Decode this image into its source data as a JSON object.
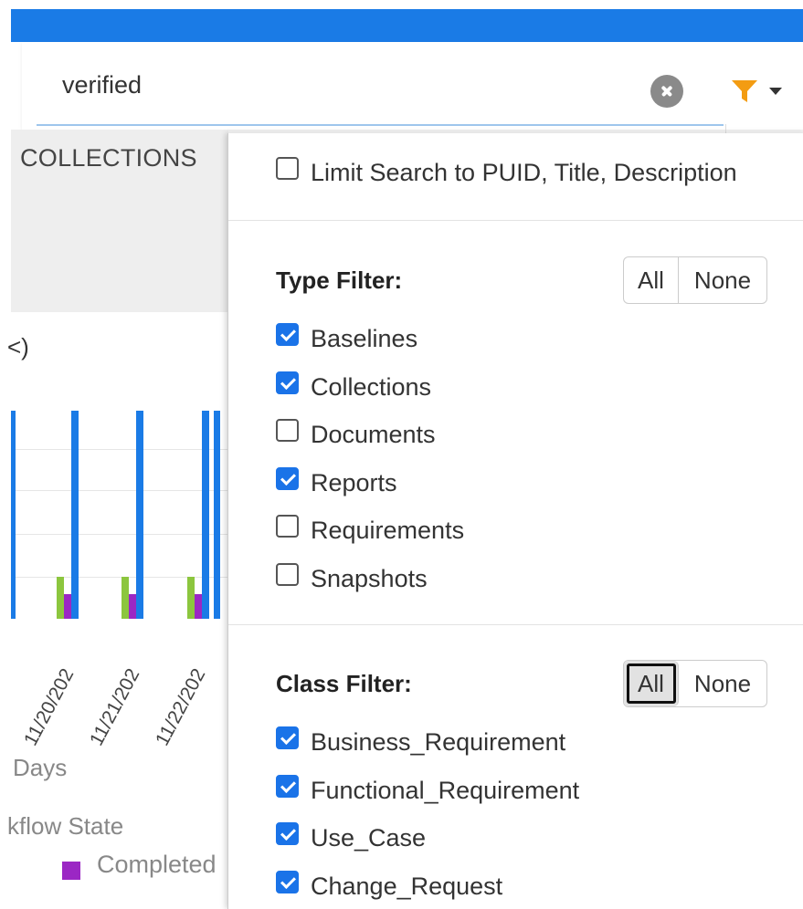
{
  "search": {
    "value": "verified"
  },
  "background": {
    "tab_label": "COLLECTIONS",
    "chart_title_fragment": "<)",
    "x_axis_label_fragment": "Days",
    "legend_title_fragment": "kflow State",
    "legend_item": "Completed"
  },
  "chart_data": {
    "type": "bar",
    "categories": [
      "11/20/202",
      "11/21/202",
      "11/22/202"
    ],
    "series": [
      {
        "color": "#8cc63e",
        "values": [
          1,
          1,
          1
        ]
      },
      {
        "color": "#9b27c4",
        "values": [
          0.6,
          0.6,
          0.6
        ]
      },
      {
        "color": "#1a7be6",
        "values": [
          5,
          5,
          5
        ]
      }
    ]
  },
  "dropdown": {
    "limit_search": {
      "label": "Limit Search to PUID, Title, Description",
      "checked": false
    },
    "type_filter": {
      "title": "Type Filter:",
      "all_label": "All",
      "none_label": "None",
      "items": [
        {
          "label": "Baselines",
          "checked": true
        },
        {
          "label": "Collections",
          "checked": true
        },
        {
          "label": "Documents",
          "checked": false
        },
        {
          "label": "Reports",
          "checked": true
        },
        {
          "label": "Requirements",
          "checked": false
        },
        {
          "label": "Snapshots",
          "checked": false
        }
      ]
    },
    "class_filter": {
      "title": "Class Filter:",
      "all_label": "All",
      "none_label": "None",
      "items": [
        {
          "label": "Business_Requirement",
          "checked": true
        },
        {
          "label": "Functional_Requirement",
          "checked": true
        },
        {
          "label": "Use_Case",
          "checked": true
        },
        {
          "label": "Change_Request",
          "checked": true
        }
      ]
    }
  },
  "colors": {
    "accent": "#1a7be6",
    "filter_icon": "#f39c12",
    "checkbox": "#1a73e8"
  }
}
